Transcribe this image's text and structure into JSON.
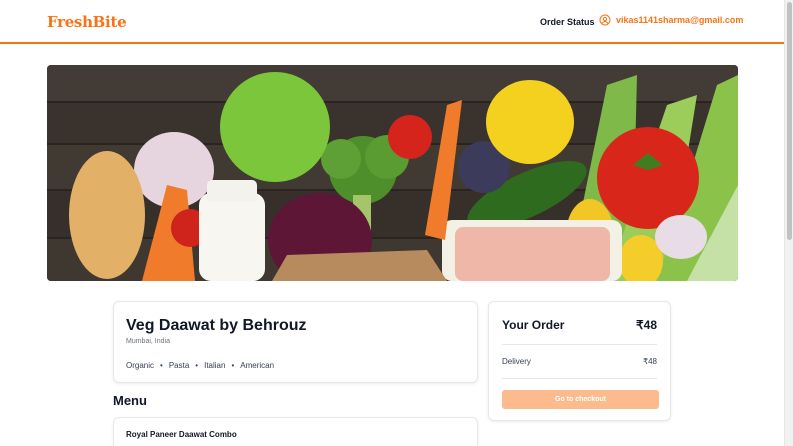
{
  "header": {
    "logo": "FreshBite",
    "order_status_label": "Order Status",
    "user_email": "vikas1141sharma@gmail.com",
    "user_icon": "user-circle-icon"
  },
  "hero": {
    "image_description": "fresh vegetables and fruits on dark wooden table"
  },
  "restaurant": {
    "name": "Veg Daawat by Behrouz",
    "location": "Mumbai, India",
    "cuisines": [
      "Organic",
      "Pasta",
      "Italian",
      "American"
    ],
    "separator": "•"
  },
  "menu": {
    "heading": "Menu",
    "items": [
      {
        "name": "Royal Paneer Daawat Combo"
      }
    ]
  },
  "order": {
    "title": "Your Order",
    "total": "₹48",
    "delivery_label": "Delivery",
    "delivery_value": "₹48",
    "checkout_label": "Go to checkout"
  },
  "colors": {
    "brand": "#f97316",
    "checkout_disabled": "#fdba8c",
    "text_primary": "#111827",
    "border": "#e5e7eb"
  }
}
